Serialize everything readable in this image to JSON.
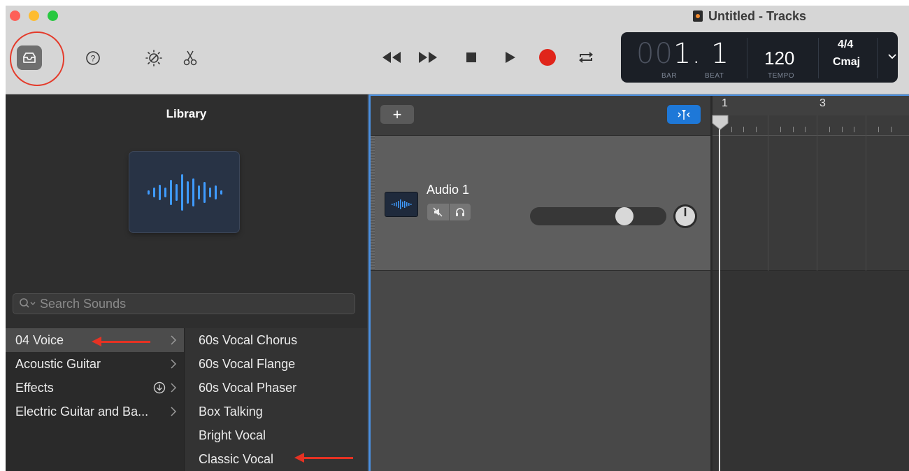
{
  "window": {
    "title": "Untitled - Tracks"
  },
  "toolbar": {
    "library_button": "library-icon",
    "help_button": "?",
    "tuner_icon": "metronome-brightness-icon",
    "scissors_icon": "scissors-icon"
  },
  "transport": {
    "rewind": "rewind-icon",
    "forward": "fast-forward-icon",
    "stop": "stop-icon",
    "play": "play-icon",
    "record": "record-icon",
    "cycle": "cycle-icon",
    "record_color": "#e0251b"
  },
  "lcd": {
    "bar_dim": "00",
    "position": "1. 1",
    "bar_label": "BAR",
    "beat_label": "BEAT",
    "tempo": "120",
    "tempo_label": "TEMPO",
    "time_signature": "4/4",
    "key": "Cmaj"
  },
  "library": {
    "title": "Library",
    "search_placeholder": "Search Sounds",
    "categories": [
      {
        "label": "04 Voice",
        "selected": true
      },
      {
        "label": "Acoustic Guitar",
        "selected": false
      },
      {
        "label": "Effects",
        "selected": false
      },
      {
        "label": "Electric Guitar and Ba...",
        "selected": false
      }
    ],
    "patches": [
      "60s Vocal Chorus",
      "60s Vocal Flange",
      "60s Vocal Phaser",
      "Box Talking",
      "Bright Vocal",
      "Classic Vocal"
    ]
  },
  "tracks": {
    "add_label": "+",
    "items": [
      {
        "name": "Audio 1",
        "volume": 0.72,
        "mute_icon": "mute-icon",
        "solo_icon": "headphones-icon"
      }
    ]
  },
  "ruler": {
    "bars": [
      "1",
      "3"
    ]
  },
  "colors": {
    "accent_blue": "#1e78d8",
    "annotation_red": "#e43a2a"
  }
}
